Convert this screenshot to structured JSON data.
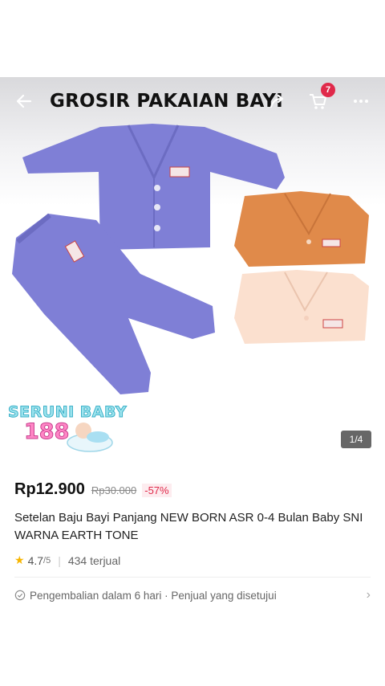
{
  "header": {
    "title": "GROSIR PAKAIAN BAYI",
    "cart_count": "7"
  },
  "gallery": {
    "counter": "1/4",
    "store_logo_text": "SERUNI BABY",
    "store_logo_number": "188"
  },
  "product": {
    "price": "Rp12.900",
    "original_price": "Rp30.000",
    "discount": "-57%",
    "title": "Setelan Baju Bayi Panjang NEW BORN ASR 0-4 Bulan Baby SNI WARNA EARTH TONE",
    "rating": "4.7",
    "rating_of": "/5",
    "sold": "434 terjual"
  },
  "service": {
    "text": "Pengembalian dalam 6 hari · Penjual yang disetujui"
  },
  "colors": {
    "accent": "#e0294a",
    "purple_garment": "#7f7fd6",
    "orange_garment": "#e08a4a",
    "peach_garment": "#fbe0cf"
  }
}
